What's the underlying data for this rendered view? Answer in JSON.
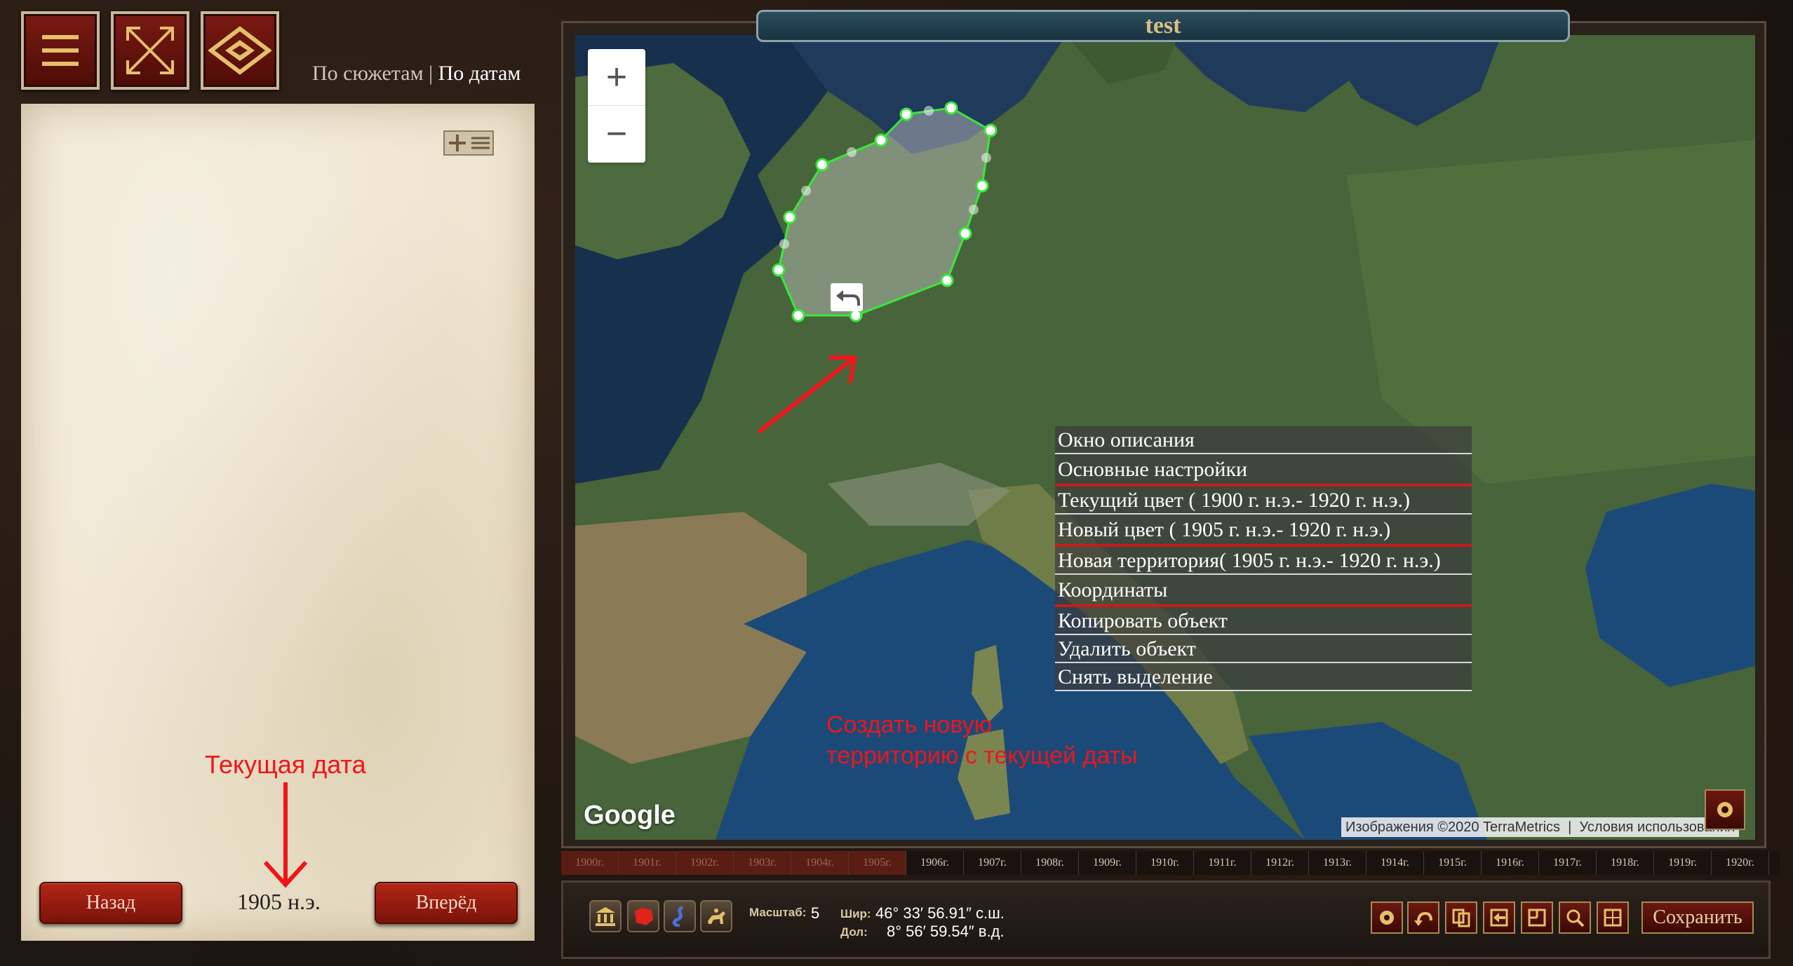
{
  "nav": {
    "mode_plots": "По сюжетам",
    "separator": "|",
    "mode_dates": "По датам"
  },
  "map": {
    "title": "test",
    "zoom_in": "+",
    "zoom_out": "−",
    "google_logo": "Google",
    "attribution": "Изображения ©2020 TerraMetrics",
    "terms": "Условия использования"
  },
  "context_menu": [
    "Окно описания",
    "Основные настройки",
    "Текущий цвет ( 1900 г. н.э.- 1920 г. н.э.)",
    "Новый цвет ( 1905 г. н.э.- 1920 г. н.э.)",
    "Новая территория( 1905 г. н.э.- 1920 г. н.э.)",
    "Координаты",
    "Копировать объект",
    "Удалить объект",
    "Снять выделение"
  ],
  "annotations": {
    "current_date": "Текущая дата",
    "create_territory_line1": "Создать новую",
    "create_territory_line2": "территорию с текущей даты"
  },
  "panel": {
    "back": "Назад",
    "forward": "Вперёд",
    "current_date": "1905 н.э."
  },
  "timeline": [
    "1900г.",
    "1901г.",
    "1902г.",
    "1903г.",
    "1904г.",
    "1905г.",
    "1906г.",
    "1907г.",
    "1908г.",
    "1909г.",
    "1910г.",
    "1911г.",
    "1912г.",
    "1913г.",
    "1914г.",
    "1915г.",
    "1916г.",
    "1917г.",
    "1918г.",
    "1919г.",
    "1920г."
  ],
  "toolbar": {
    "scale_label": "Масштаб:",
    "scale_value": "5",
    "lat_label": "Шир:",
    "lat_value": "46° 33′ 56.91″ с.ш.",
    "lon_label": "Дол:",
    "lon_value": "8° 56′ 59.54″ в.д.",
    "save": "Сохранить"
  },
  "colors": {
    "accent_red": "#7b130a",
    "polygon_stroke": "#39e83a",
    "annotation": "#f0151a"
  }
}
